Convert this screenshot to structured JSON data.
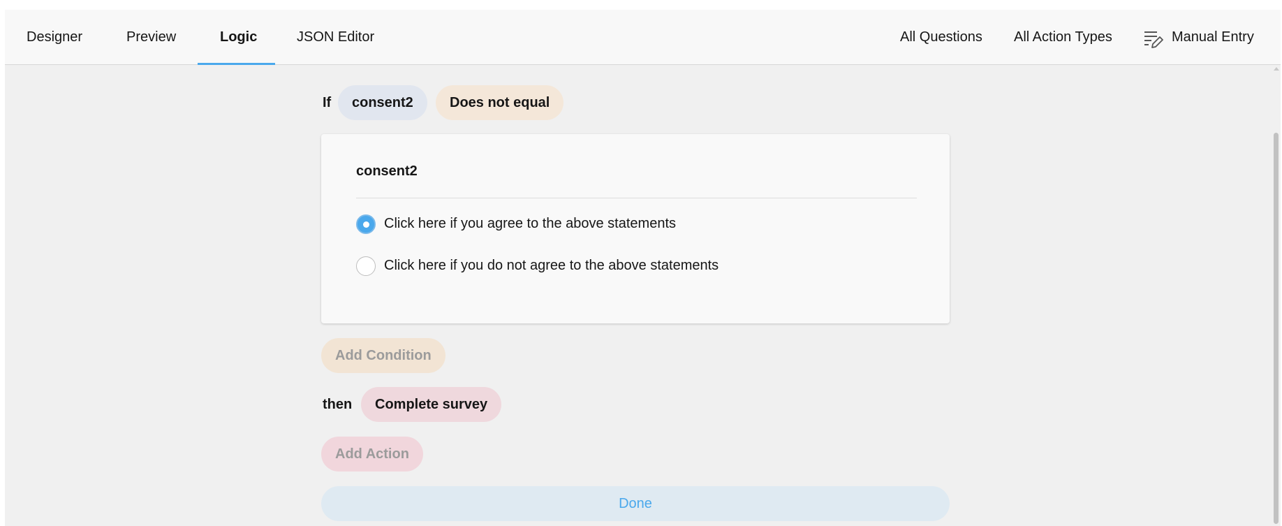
{
  "tabs": [
    {
      "label": "Designer",
      "active": false
    },
    {
      "label": "Preview",
      "active": false
    },
    {
      "label": "Logic",
      "active": true
    },
    {
      "label": "JSON Editor",
      "active": false
    }
  ],
  "toolbar": {
    "all_questions": "All Questions",
    "all_action_types": "All Action Types",
    "manual_entry": "Manual Entry",
    "manual_entry_icon": "edit-list-icon"
  },
  "rule": {
    "if_label": "If",
    "question": "consent2",
    "operator": "Does not equal",
    "value_card": {
      "title": "consent2",
      "choices": [
        {
          "label": "Click here if you agree to the above statements",
          "selected": true
        },
        {
          "label": "Click here if you do not agree to the above statements",
          "selected": false
        }
      ]
    },
    "add_condition_label": "Add Condition",
    "then_label": "then",
    "action": "Complete survey",
    "add_action_label": "Add Action",
    "done_label": "Done"
  },
  "colors": {
    "accent": "#4aa8ec",
    "question_pill": "#e1e6ef",
    "operator_pill": "#f4e7d9",
    "action_pill": "#efd8dd",
    "background": "#f0f0f0"
  }
}
